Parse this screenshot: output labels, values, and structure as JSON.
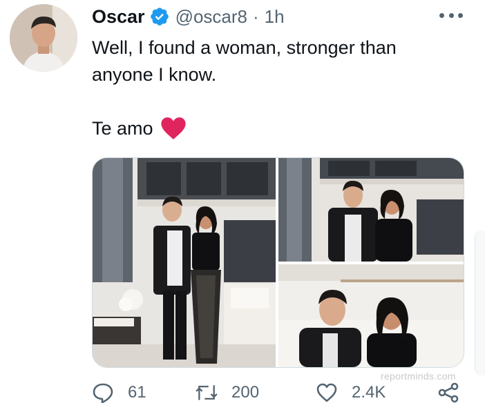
{
  "tweet": {
    "author_name": "Oscar",
    "handle": "@oscar8",
    "separator": "·",
    "time": "1h",
    "text_line1": "Well, I found a woman, stronger than",
    "text_line2": "anyone I know.",
    "text_line3": "Te amo",
    "heart_emoji": "red-heart",
    "verified": true
  },
  "actions": {
    "replies": "61",
    "retweets": "200",
    "likes": "2.4K"
  },
  "watermark": "reportminds.com",
  "colors": {
    "text": "#0f1419",
    "secondary": "#536471",
    "verified_blue": "#1d9bf0",
    "heart_red": "#e0245e",
    "border": "#cfd9de"
  },
  "icons": {
    "more": "more-dots-icon",
    "reply": "reply-icon",
    "retweet": "retweet-icon",
    "like": "like-heart-icon",
    "share": "share-icon"
  }
}
